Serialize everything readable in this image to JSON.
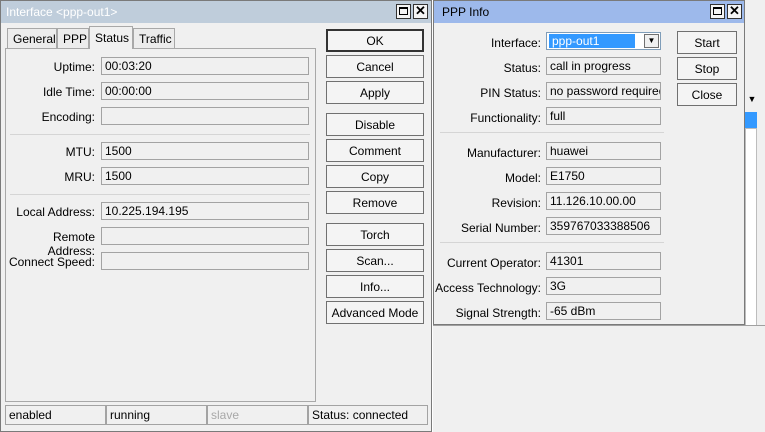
{
  "interface_window": {
    "title": "Interface <ppp-out1>",
    "tabs": [
      {
        "label": "General"
      },
      {
        "label": "PPP"
      },
      {
        "label": "Status"
      },
      {
        "label": "Traffic"
      }
    ],
    "fields": {
      "uptime": {
        "label": "Uptime:",
        "value": "00:03:20"
      },
      "idle_time": {
        "label": "Idle Time:",
        "value": "00:00:00"
      },
      "encoding": {
        "label": "Encoding:",
        "value": ""
      },
      "mtu": {
        "label": "MTU:",
        "value": "1500"
      },
      "mru": {
        "label": "MRU:",
        "value": "1500"
      },
      "local_address": {
        "label": "Local Address:",
        "value": "10.225.194.195"
      },
      "remote_address": {
        "label": "Remote Address:",
        "value": ""
      },
      "connect_speed": {
        "label": "Connect Speed:",
        "value": ""
      }
    },
    "buttons": {
      "ok": "OK",
      "cancel": "Cancel",
      "apply": "Apply",
      "disable": "Disable",
      "comment": "Comment",
      "copy": "Copy",
      "remove": "Remove",
      "torch": "Torch",
      "scan": "Scan...",
      "info": "Info...",
      "advanced_mode": "Advanced Mode"
    },
    "statusbar": {
      "enabled": "enabled",
      "running": "running",
      "slave": "slave",
      "status": "Status: connected"
    }
  },
  "ppp_info_window": {
    "title": "PPP Info",
    "interface": {
      "label": "Interface:",
      "value": "ppp-out1"
    },
    "fields": {
      "status": {
        "label": "Status:",
        "value": "call in progress"
      },
      "pin_status": {
        "label": "PIN Status:",
        "value": "no password required"
      },
      "functionality": {
        "label": "Functionality:",
        "value": "full"
      },
      "manufacturer": {
        "label": "Manufacturer:",
        "value": "huawei"
      },
      "model": {
        "label": "Model:",
        "value": "E1750"
      },
      "revision": {
        "label": "Revision:",
        "value": "11.126.10.00.00"
      },
      "serial_number": {
        "label": "Serial Number:",
        "value": "359767033388506"
      },
      "current_operator": {
        "label": "Current Operator:",
        "value": "41301"
      },
      "access_technology": {
        "label": "Access Technology:",
        "value": "3G"
      },
      "signal_strength": {
        "label": "Signal Strength:",
        "value": "-65 dBm"
      }
    },
    "buttons": {
      "start": "Start",
      "stop": "Stop",
      "close": "Close"
    }
  },
  "icons": {
    "maximize": "maximize-icon",
    "close_glyph": "✕",
    "dropdown_glyph": "▼"
  }
}
